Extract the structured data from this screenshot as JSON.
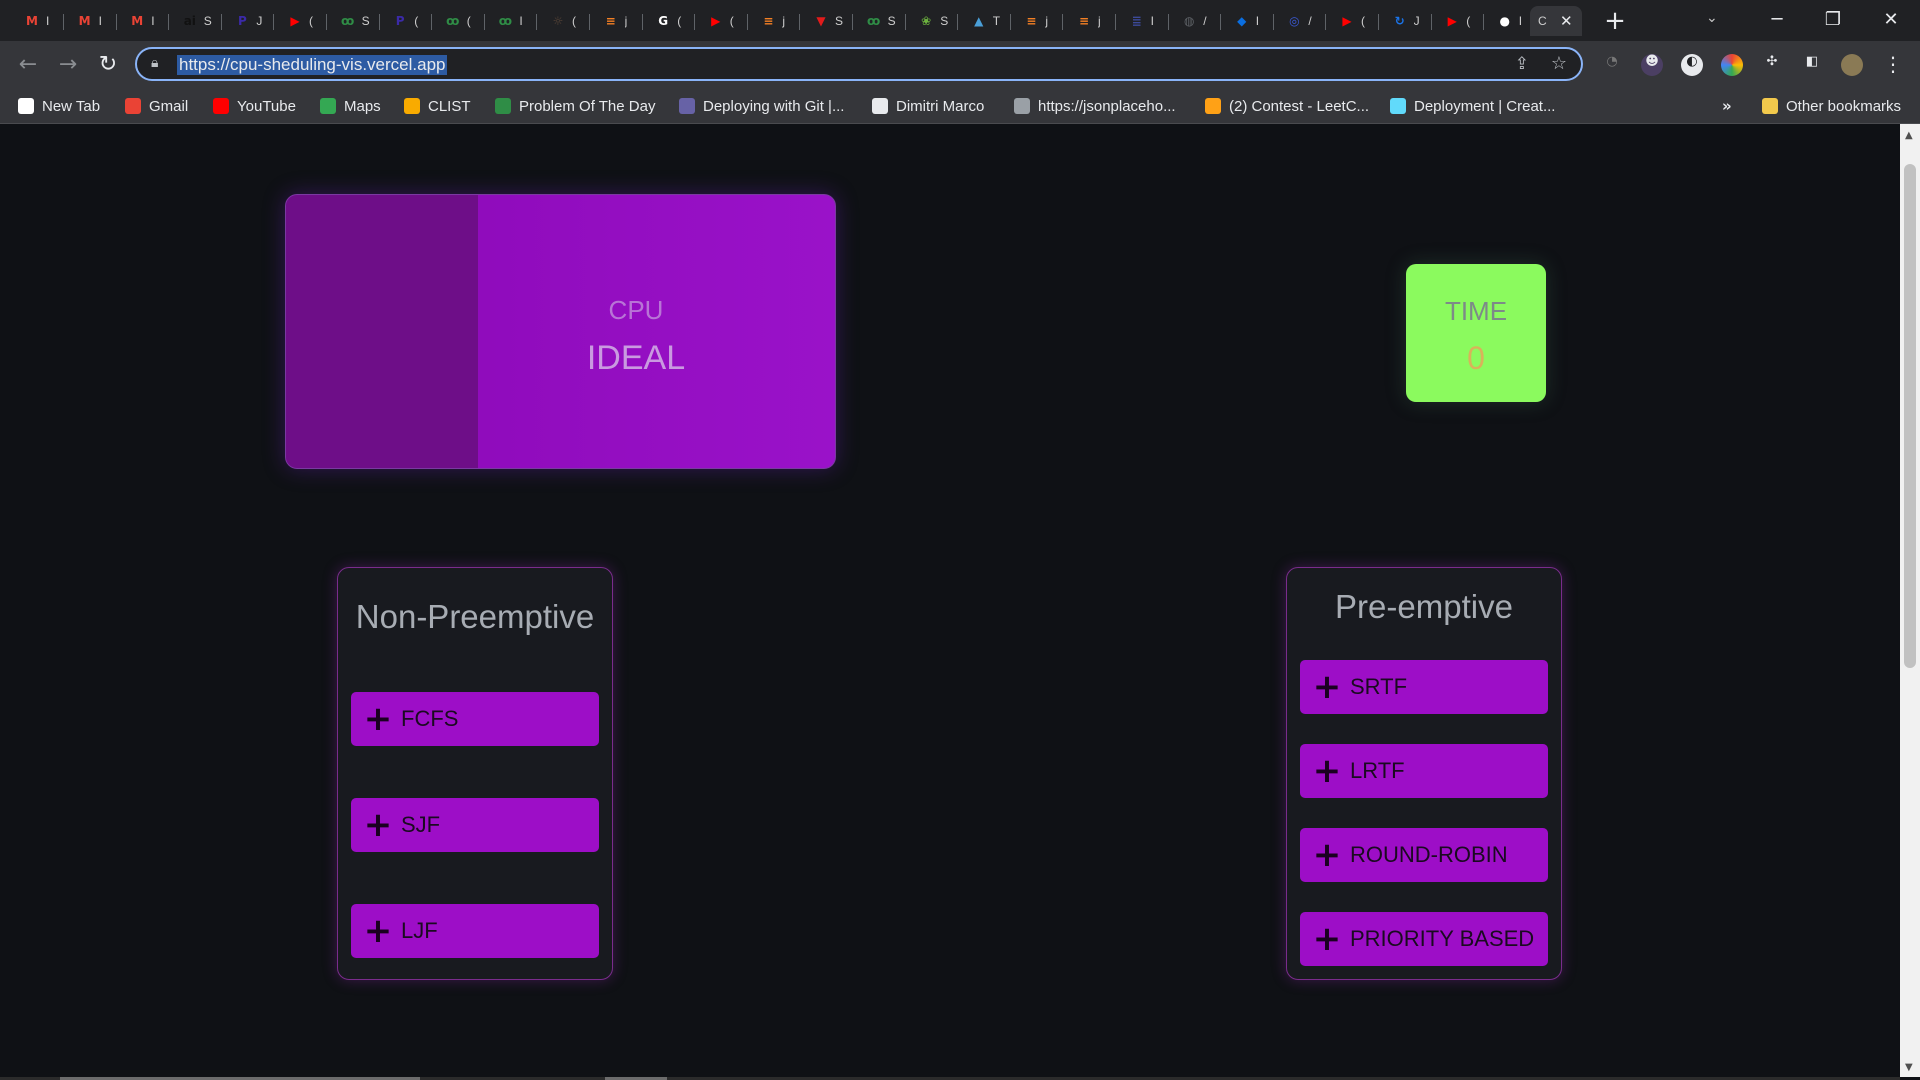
{
  "browser": {
    "tabs": [
      {
        "icon": "gmail-icon",
        "letter": "M",
        "color": "#ea4335",
        "text": "I"
      },
      {
        "icon": "gmail-icon",
        "letter": "M",
        "color": "#ea4335",
        "text": "I"
      },
      {
        "icon": "gmail-icon",
        "letter": "M",
        "color": "#ea4335",
        "text": "I"
      },
      {
        "icon": "ai-icon",
        "letter": "ai",
        "color": "#111111",
        "text": "S"
      },
      {
        "icon": "p-icon",
        "letter": "P",
        "color": "#3b2aa8",
        "text": "J"
      },
      {
        "icon": "youtube-icon",
        "letter": "▶",
        "color": "#ff0000",
        "text": "("
      },
      {
        "icon": "gfg-icon",
        "letter": "ꝏ",
        "color": "#2f8d46",
        "text": "S"
      },
      {
        "icon": "p-icon",
        "letter": "P",
        "color": "#3b2aa8",
        "text": "("
      },
      {
        "icon": "gfg-icon",
        "letter": "ꝏ",
        "color": "#2f8d46",
        "text": "("
      },
      {
        "icon": "gfg-icon",
        "letter": "ꝏ",
        "color": "#2f8d46",
        "text": "I"
      },
      {
        "icon": "codechef-icon",
        "letter": "☼",
        "color": "#5b4638",
        "text": "("
      },
      {
        "icon": "stackoverflow-icon",
        "letter": "≡",
        "color": "#f48024",
        "text": "j"
      },
      {
        "icon": "google-icon",
        "letter": "G",
        "color": "#ffffff",
        "text": "("
      },
      {
        "icon": "youtube-icon",
        "letter": "▶",
        "color": "#ff0000",
        "text": "("
      },
      {
        "icon": "stackoverflow-icon",
        "letter": "≡",
        "color": "#f48024",
        "text": "j"
      },
      {
        "icon": "vercel-icon",
        "letter": "▼",
        "color": "#e21b1b",
        "text": "S"
      },
      {
        "icon": "gfg-icon",
        "letter": "ꝏ",
        "color": "#2f8d46",
        "text": "S"
      },
      {
        "icon": "spring-icon",
        "letter": "❀",
        "color": "#6db33f",
        "text": "S"
      },
      {
        "icon": "mountain-icon",
        "letter": "▲",
        "color": "#4a9fd8",
        "text": "T"
      },
      {
        "icon": "stackoverflow-icon",
        "letter": "≡",
        "color": "#f48024",
        "text": "j"
      },
      {
        "icon": "stackoverflow-icon",
        "letter": "≡",
        "color": "#f48024",
        "text": "j"
      },
      {
        "icon": "docs-icon",
        "letter": "≣",
        "color": "#3c4a9a",
        "text": "I"
      },
      {
        "icon": "globe-icon",
        "letter": "◍",
        "color": "#5f6368",
        "text": "/"
      },
      {
        "icon": "azure-icon",
        "letter": "◆",
        "color": "#0a6ee0",
        "text": "I"
      },
      {
        "icon": "globe-icon",
        "letter": "◎",
        "color": "#3b5bdb",
        "text": "/"
      },
      {
        "icon": "youtube-icon",
        "letter": "▶",
        "color": "#ff0000",
        "text": "("
      },
      {
        "icon": "loop-icon",
        "letter": "↻",
        "color": "#1a73e8",
        "text": "J"
      },
      {
        "icon": "youtube-icon",
        "letter": "▶",
        "color": "#ff0000",
        "text": "("
      },
      {
        "icon": "github-icon",
        "letter": "●",
        "color": "#ffffff",
        "text": "I"
      }
    ],
    "active_tab_text": "C",
    "new_tab": "+",
    "url": "https://cpu-sheduling-vis.vercel.app",
    "bookmarks": [
      {
        "label": "New Tab",
        "icon": "newtab-icon",
        "color": "#ffffff"
      },
      {
        "label": "Gmail",
        "icon": "gmail-icon",
        "color": "#ea4335"
      },
      {
        "label": "YouTube",
        "icon": "youtube-icon",
        "color": "#ff0000"
      },
      {
        "label": "Maps",
        "icon": "maps-icon",
        "color": "#34a853"
      },
      {
        "label": "CLIST",
        "icon": "clist-icon",
        "color": "#f9ab00"
      },
      {
        "label": "Problem Of The Day",
        "icon": "gfg-icon",
        "color": "#2f8d46"
      },
      {
        "label": "Deploying with Git |...",
        "icon": "heroku-icon",
        "color": "#6762a6"
      },
      {
        "label": "Dimitri Marco",
        "icon": "globe-icon",
        "color": "#e8eaed"
      },
      {
        "label": "https://jsonplaceho...",
        "icon": "page-icon",
        "color": "#9aa0a6"
      },
      {
        "label": "(2) Contest - LeetC...",
        "icon": "leetcode-icon",
        "color": "#ffa116"
      },
      {
        "label": "Deployment | Creat...",
        "icon": "react-icon",
        "color": "#61dafb"
      }
    ],
    "more_bookmarks": "»",
    "other_bookmarks": "Other bookmarks"
  },
  "cpu": {
    "label": "CPU",
    "status": "IDEAL"
  },
  "time": {
    "label": "TIME",
    "value": "0"
  },
  "non_preemptive": {
    "title": "Non-Preemptive",
    "buttons": [
      "FCFS",
      "SJF",
      "LJF"
    ]
  },
  "preemptive": {
    "title": "Pre-emptive",
    "buttons": [
      "SRTF",
      "LRTF",
      "ROUND-ROBIN",
      "PRIORITY BASED"
    ]
  },
  "colors": {
    "cpu_card": "#9a12c9",
    "time_card": "#8bfa5e",
    "algo_button": "#9d0ec7",
    "background": "#0f1115"
  }
}
